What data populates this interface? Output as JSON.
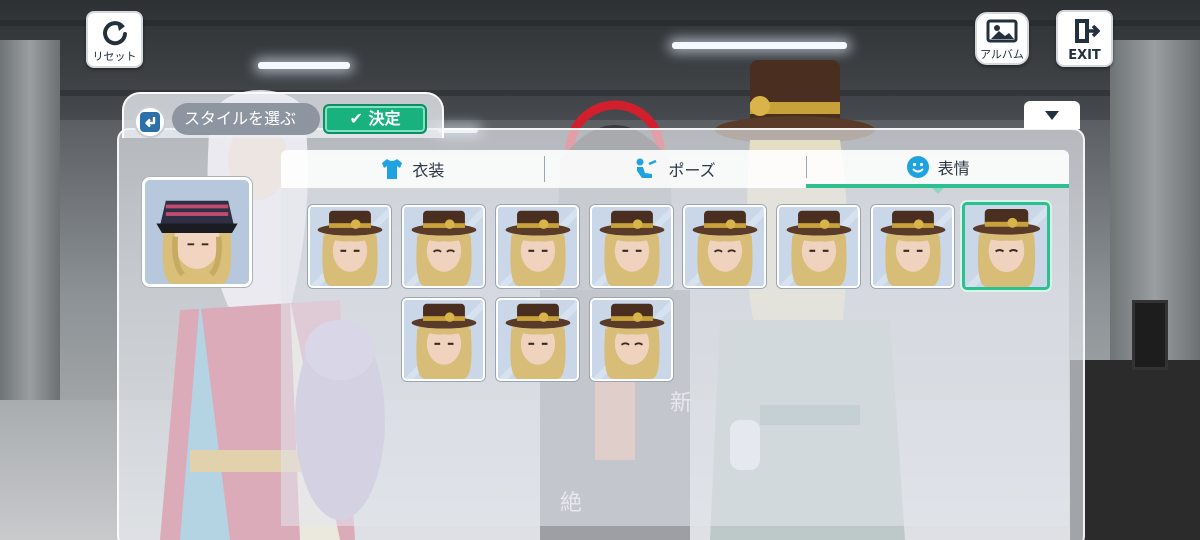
{
  "top_bar": {
    "reset_label": "リセット",
    "album_label": "アルバム",
    "exit_label": "EXIT"
  },
  "header": {
    "style_label": "スタイルを選ぶ",
    "confirm_label": "決定"
  },
  "tabs": [
    {
      "label": "衣装",
      "icon": "shirt-icon",
      "active": false
    },
    {
      "label": "ポーズ",
      "icon": "pose-icon",
      "active": false
    },
    {
      "label": "表情",
      "icon": "smile-icon",
      "active": true
    }
  ],
  "expressions": {
    "count": 11,
    "selected_index": 7
  },
  "colors": {
    "accent": "#2dbf8f",
    "confirm": "#19b27e",
    "tab_icon": "#1fa3e0"
  }
}
